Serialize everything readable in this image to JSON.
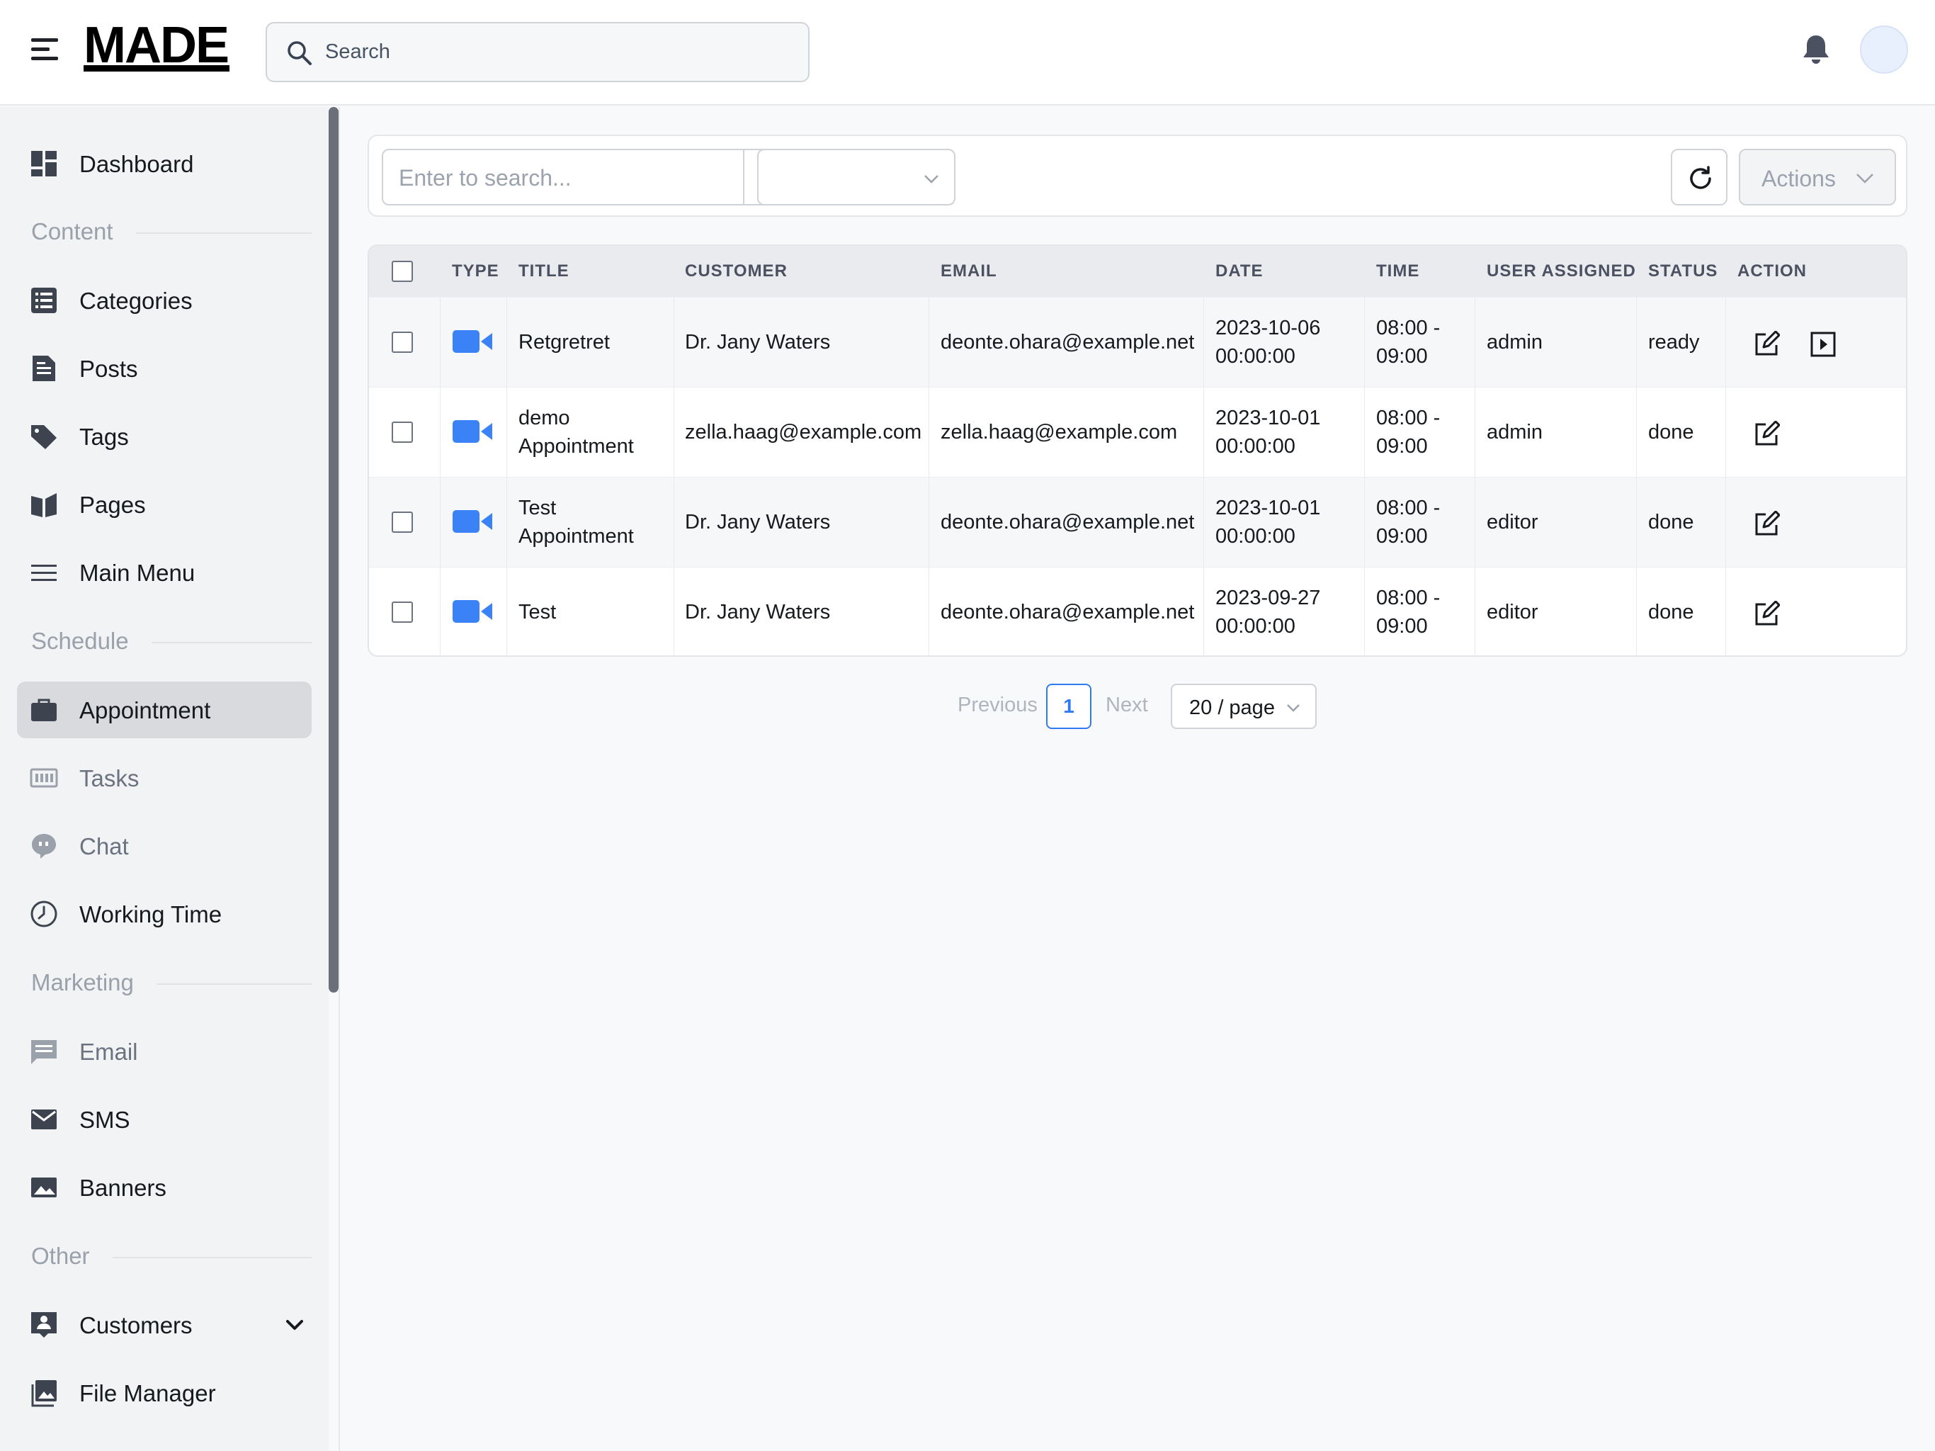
{
  "header": {
    "logo": "MADE",
    "search_placeholder": "Search"
  },
  "sidebar": {
    "items": [
      {
        "label": "Dashboard",
        "icon": "dashboard-icon"
      },
      {
        "label": "Categories",
        "icon": "list-icon"
      },
      {
        "label": "Posts",
        "icon": "document-icon"
      },
      {
        "label": "Tags",
        "icon": "tag-icon"
      },
      {
        "label": "Pages",
        "icon": "book-icon"
      },
      {
        "label": "Main Menu",
        "icon": "menu-icon"
      },
      {
        "label": "Appointment",
        "icon": "briefcase-icon",
        "active": true
      },
      {
        "label": "Tasks",
        "icon": "tasks-icon"
      },
      {
        "label": "Chat",
        "icon": "chat-icon"
      },
      {
        "label": "Working Time",
        "icon": "clock-icon"
      },
      {
        "label": "Email",
        "icon": "email-icon"
      },
      {
        "label": "SMS",
        "icon": "envelope-icon"
      },
      {
        "label": "Banners",
        "icon": "image-icon"
      },
      {
        "label": "Customers",
        "icon": "customer-icon"
      },
      {
        "label": "File Manager",
        "icon": "gallery-icon"
      }
    ],
    "sections": [
      "Content",
      "Schedule",
      "Marketing",
      "Other"
    ]
  },
  "toolbar": {
    "search_placeholder": "Enter to search...",
    "select_value": "",
    "actions_label": "Actions"
  },
  "table": {
    "columns": [
      "TYPE",
      "TITLE",
      "CUSTOMER",
      "EMAIL",
      "DATE",
      "TIME",
      "USER ASSIGNED",
      "STATUS",
      "ACTION"
    ],
    "rows": [
      {
        "title": [
          "Retgretret"
        ],
        "customer": "Dr. Jany Waters",
        "email": "deonte.ohara@example.net",
        "date": [
          "2023-10-06",
          "00:00:00"
        ],
        "time": [
          "08:00 -",
          "09:00"
        ],
        "user": "admin",
        "status": "ready"
      },
      {
        "title": [
          "demo",
          "Appointment"
        ],
        "customer": "zella.haag@example.com",
        "email": "zella.haag@example.com",
        "date": [
          "2023-10-01",
          "00:00:00"
        ],
        "time": [
          "08:00 -",
          "09:00"
        ],
        "user": "admin",
        "status": "done"
      },
      {
        "title": [
          "Test",
          "Appointment"
        ],
        "customer": "Dr. Jany Waters",
        "email": "deonte.ohara@example.net",
        "date": [
          "2023-10-01",
          "00:00:00"
        ],
        "time": [
          "08:00 -",
          "09:00"
        ],
        "user": "editor",
        "status": "done"
      },
      {
        "title": [
          "Test"
        ],
        "customer": "Dr. Jany Waters",
        "email": "deonte.ohara@example.net",
        "date": [
          "2023-09-27",
          "00:00:00"
        ],
        "time": [
          "08:00 -",
          "09:00"
        ],
        "user": "editor",
        "status": "done"
      }
    ]
  },
  "pagination": {
    "previous": "Previous",
    "current": "1",
    "next": "Next",
    "page_size": "20 / page"
  },
  "colors": {
    "accent": "#2f7bf5",
    "video_icon": "#3b82f6"
  }
}
